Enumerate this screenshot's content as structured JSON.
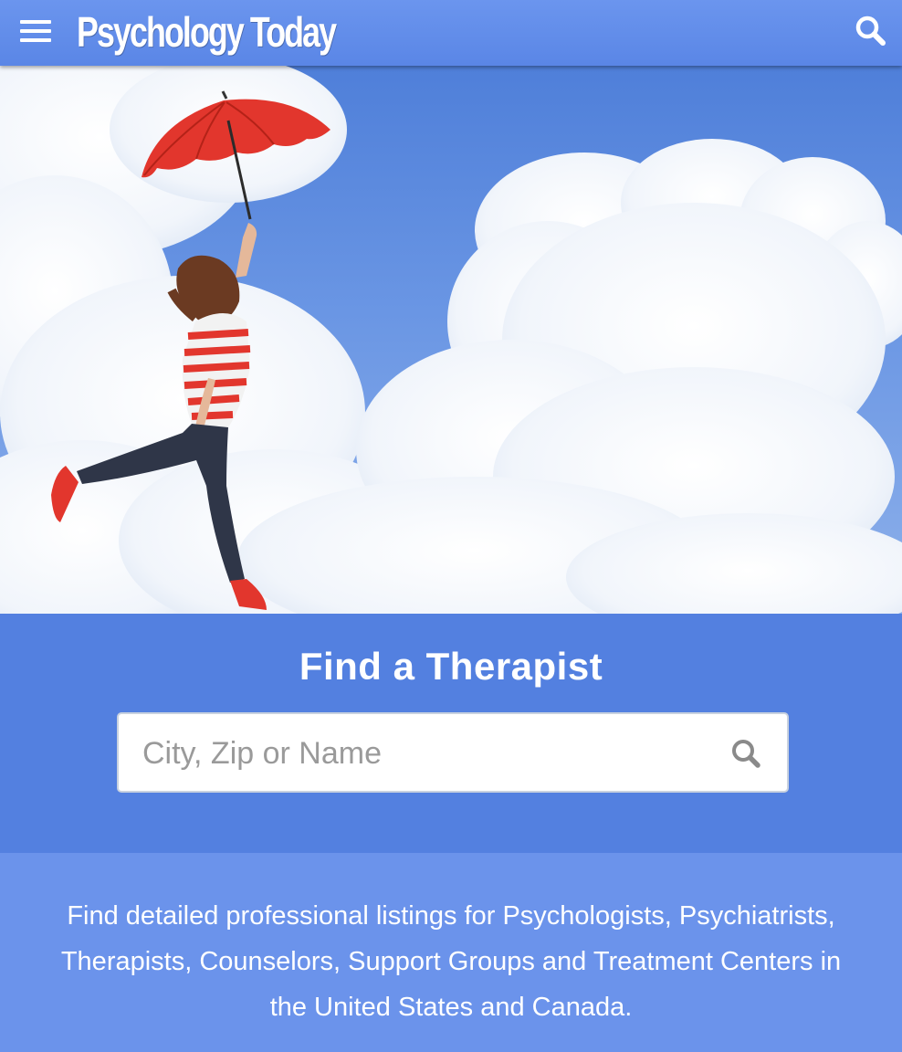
{
  "header": {
    "logo": "Psychology Today",
    "menu_icon": "hamburger-menu-icon",
    "search_icon": "search-icon"
  },
  "hero": {
    "image": "woman-flying-with-red-umbrella-in-cloudy-sky"
  },
  "find_therapist": {
    "title": "Find a Therapist",
    "search_placeholder": "City, Zip or Name",
    "search_value": "",
    "search_icon": "search-icon"
  },
  "description": {
    "text": "Find detailed professional listings for Psychologists, Psychiatrists, Therapists, Counselors, Support Groups and Treatment Centers in the United States and Canada."
  },
  "colors": {
    "header_blue": "#6b95ee",
    "find_band_blue": "#5380e0",
    "description_blue": "#6b93eb",
    "umbrella_red": "#e2362d"
  }
}
